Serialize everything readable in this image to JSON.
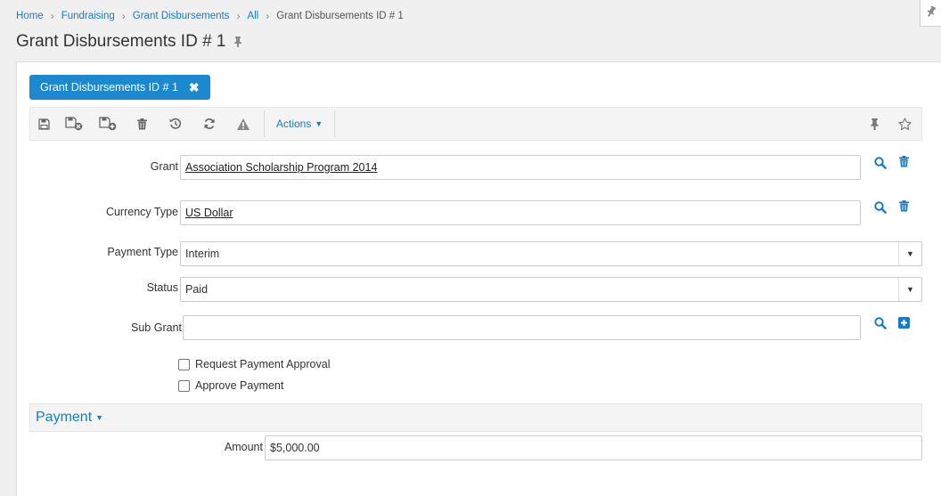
{
  "breadcrumb": {
    "items": [
      "Home",
      "Fundraising",
      "Grant Disbursements",
      "All"
    ],
    "current": "Grant Disbursements ID # 1"
  },
  "page": {
    "title": "Grant Disbursements ID # 1"
  },
  "record_tab": {
    "label": "Grant Disbursements ID # 1",
    "close": "✖"
  },
  "toolbar": {
    "icons": [
      "save-icon",
      "save-and-close-icon",
      "save-and-new-icon",
      "delete-icon",
      "history-icon",
      "refresh-icon",
      "warning-icon"
    ],
    "actions_label": "Actions",
    "right_icons": [
      "pin-icon",
      "star-icon"
    ]
  },
  "form": {
    "grant": {
      "label": "Grant",
      "value": "Association Scholarship Program 2014"
    },
    "currency_type": {
      "label": "Currency Type",
      "value": "US Dollar"
    },
    "payment_type": {
      "label": "Payment Type",
      "value": "Interim"
    },
    "status": {
      "label": "Status",
      "value": "Paid"
    },
    "sub_grant": {
      "label": "Sub Grant",
      "value": ""
    },
    "request_payment_approval": {
      "label": "Request Payment Approval",
      "checked": false
    },
    "approve_payment": {
      "label": "Approve Payment",
      "checked": false
    }
  },
  "payment_section": {
    "title": "Payment",
    "amount": {
      "label": "Amount",
      "value": "$5,000.00"
    }
  },
  "colors": {
    "accent": "#1b88d0",
    "link": "#1a7ac4"
  }
}
